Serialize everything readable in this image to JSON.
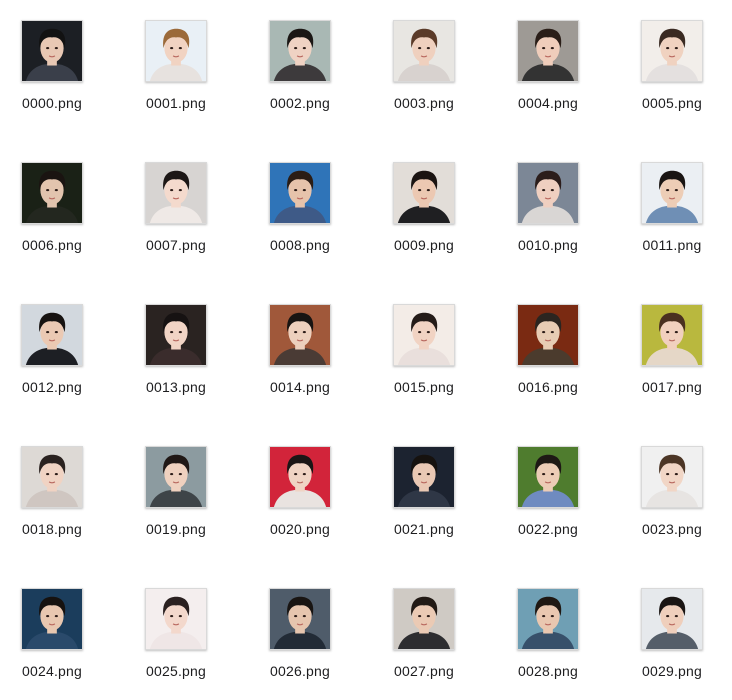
{
  "files": [
    {
      "name": "0000.png",
      "bg": "#1c1f24",
      "skin": "#e8c8b4",
      "hair": "#121212",
      "cloth": "#3a3f4a"
    },
    {
      "name": "0001.png",
      "bg": "#e9f0f6",
      "skin": "#f1d3c2",
      "hair": "#9b6a3a",
      "cloth": "#e7e2df"
    },
    {
      "name": "0002.png",
      "bg": "#a9b8b4",
      "skin": "#efd2c3",
      "hair": "#1b1715",
      "cloth": "#3d3a3c"
    },
    {
      "name": "0003.png",
      "bg": "#e8e6e2",
      "skin": "#efd0be",
      "hair": "#5b3b29",
      "cloth": "#d8d2cf"
    },
    {
      "name": "0004.png",
      "bg": "#9e9a95",
      "skin": "#efcdbb",
      "hair": "#2a1e18",
      "cloth": "#333333"
    },
    {
      "name": "0005.png",
      "bg": "#f2eeea",
      "skin": "#f0d2c0",
      "hair": "#3a2a22",
      "cloth": "#e4e0df"
    },
    {
      "name": "0006.png",
      "bg": "#1a2116",
      "skin": "#e2c4ae",
      "hair": "#1a1411",
      "cloth": "#23271f"
    },
    {
      "name": "0007.png",
      "bg": "#d7d4d2",
      "skin": "#f4dacd",
      "hair": "#1c1716",
      "cloth": "#efe9e6"
    },
    {
      "name": "0008.png",
      "bg": "#2f74b8",
      "skin": "#e6c3ab",
      "hair": "#2b1d15",
      "cloth": "#3e5a87"
    },
    {
      "name": "0009.png",
      "bg": "#e2ddd8",
      "skin": "#ecc8b2",
      "hair": "#1b1412",
      "cloth": "#1f1f22"
    },
    {
      "name": "0010.png",
      "bg": "#7c8796",
      "skin": "#efcfc0",
      "hair": "#2b1d1b",
      "cloth": "#d9d6d4"
    },
    {
      "name": "0011.png",
      "bg": "#ebeff3",
      "skin": "#edcdb6",
      "hair": "#1a1513",
      "cloth": "#6f8fb5"
    },
    {
      "name": "0012.png",
      "bg": "#d2d8de",
      "skin": "#ebc9b3",
      "hair": "#171311",
      "cloth": "#1d1f24"
    },
    {
      "name": "0013.png",
      "bg": "#2a2321",
      "skin": "#f1d4c5",
      "hair": "#161212",
      "cloth": "#3a2c2c"
    },
    {
      "name": "0014.png",
      "bg": "#a0583a",
      "skin": "#edd0bd",
      "hair": "#181412",
      "cloth": "#4a3b35"
    },
    {
      "name": "0015.png",
      "bg": "#f3ece7",
      "skin": "#f1d3c3",
      "hair": "#241b18",
      "cloth": "#e9dfdc"
    },
    {
      "name": "0016.png",
      "bg": "#7a2a12",
      "skin": "#e7ccb4",
      "hair": "#2b2520",
      "cloth": "#4b3b2d"
    },
    {
      "name": "0017.png",
      "bg": "#b9b83e",
      "skin": "#f1d0be",
      "hair": "#4a3020",
      "cloth": "#e5d7c7"
    },
    {
      "name": "0018.png",
      "bg": "#ddd9d5",
      "skin": "#f0d3c3",
      "hair": "#2a2220",
      "cloth": "#cfc6c1"
    },
    {
      "name": "0019.png",
      "bg": "#8c9ba0",
      "skin": "#efd1bf",
      "hair": "#201816",
      "cloth": "#3e4448"
    },
    {
      "name": "0020.png",
      "bg": "#d2243a",
      "skin": "#f0d4c4",
      "hair": "#1b1616",
      "cloth": "#e9e3e0"
    },
    {
      "name": "0021.png",
      "bg": "#1c2330",
      "skin": "#e9c8b4",
      "hair": "#16120f",
      "cloth": "#2f3746"
    },
    {
      "name": "0022.png",
      "bg": "#4f7c2e",
      "skin": "#ecccb6",
      "hair": "#1e1915",
      "cloth": "#6f8bc0"
    },
    {
      "name": "0023.png",
      "bg": "#f0f0f0",
      "skin": "#f1d6c6",
      "hair": "#4c3626",
      "cloth": "#e7e4e2"
    },
    {
      "name": "0024.png",
      "bg": "#1b3d5c",
      "skin": "#e8c7b0",
      "hair": "#161210",
      "cloth": "#2a4a6b"
    },
    {
      "name": "0025.png",
      "bg": "#f4eeee",
      "skin": "#f3d8cc",
      "hair": "#2a2020",
      "cloth": "#efe6e6"
    },
    {
      "name": "0026.png",
      "bg": "#4f5c6a",
      "skin": "#e6c5ae",
      "hair": "#191513",
      "cloth": "#222b36"
    },
    {
      "name": "0027.png",
      "bg": "#cfcac4",
      "skin": "#ebcab4",
      "hair": "#221a15",
      "cloth": "#2d2d30"
    },
    {
      "name": "0028.png",
      "bg": "#6f9fb4",
      "skin": "#e9c7b0",
      "hair": "#1f1813",
      "cloth": "#37506a"
    },
    {
      "name": "0029.png",
      "bg": "#e6e9ec",
      "skin": "#efcfbc",
      "hair": "#1a1513",
      "cloth": "#555e69"
    }
  ]
}
